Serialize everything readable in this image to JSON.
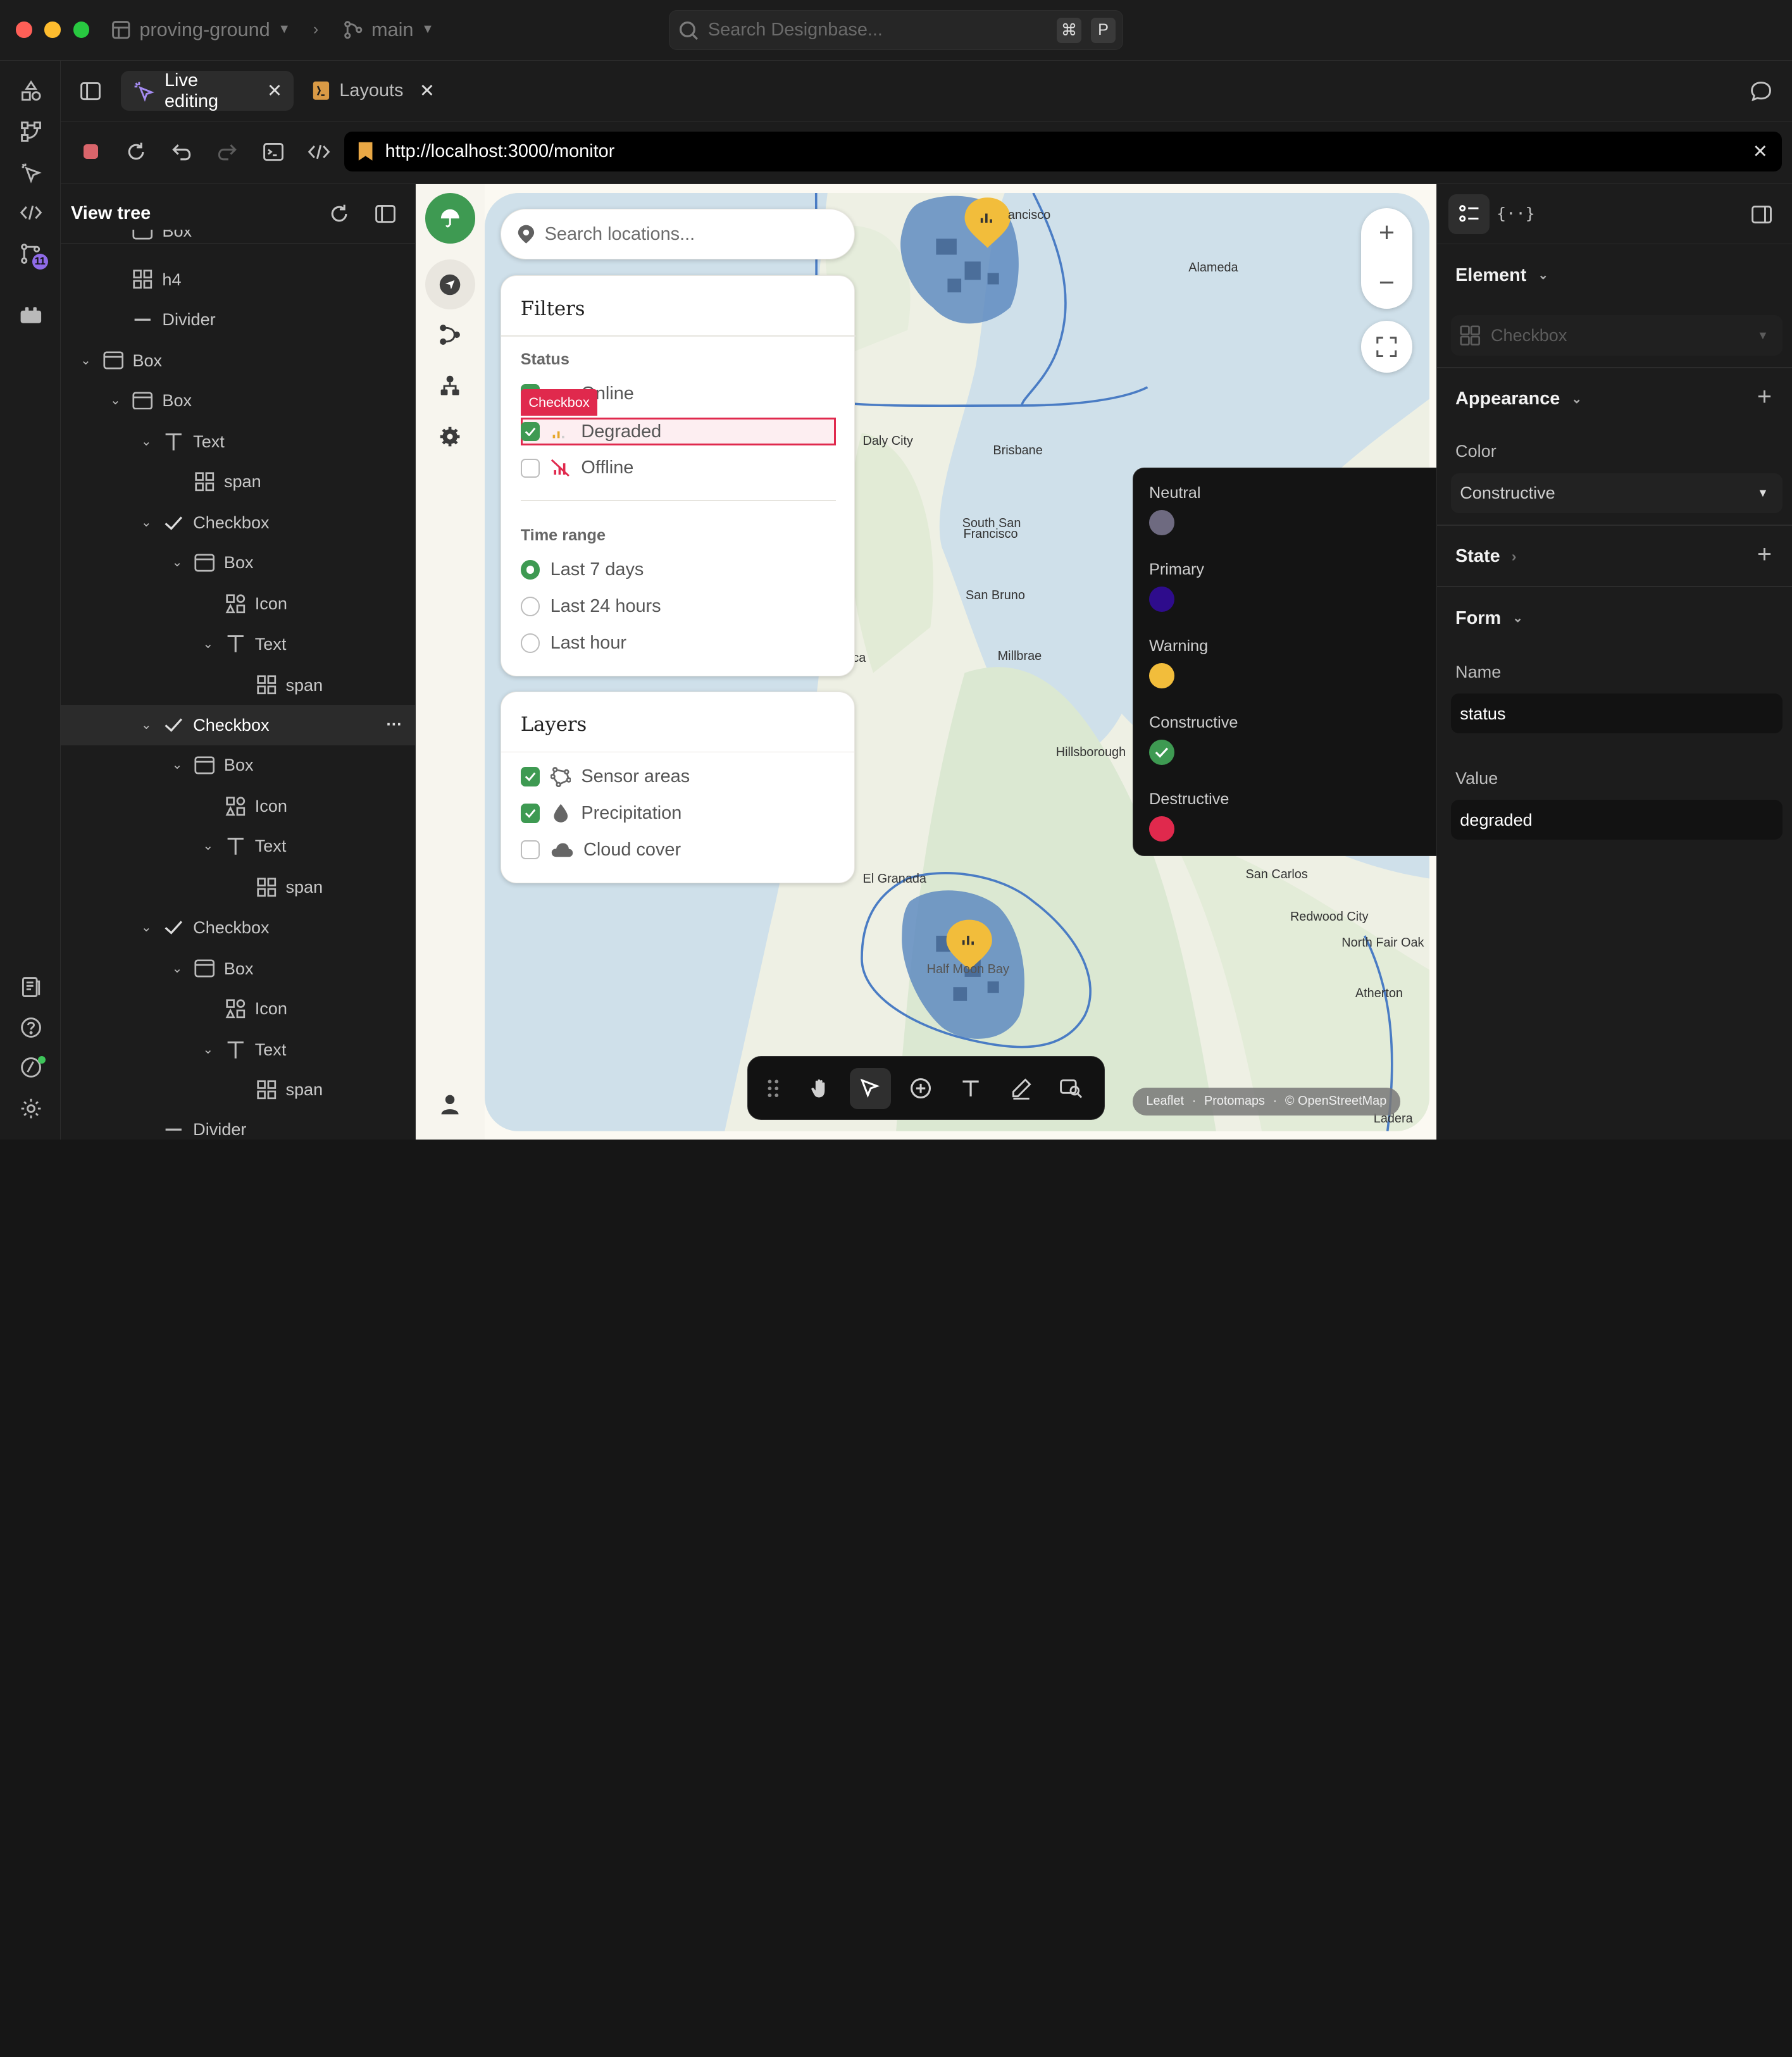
{
  "titlebar": {
    "project": "proving-ground",
    "branch": "main",
    "search_placeholder": "Search Designbase...",
    "shortcut_cmd": "⌘",
    "shortcut_key": "P"
  },
  "tabs": [
    {
      "label": "Live editing"
    },
    {
      "label": "Layouts"
    }
  ],
  "address": {
    "url": "http://localhost:3000/monitor"
  },
  "rail": {
    "badge_count": "11"
  },
  "tree": {
    "title": "View tree",
    "rows": [
      {
        "label": "h4"
      },
      {
        "label": "Divider"
      },
      {
        "label": "Box"
      },
      {
        "label": "Box"
      },
      {
        "label": "Text"
      },
      {
        "label": "span"
      },
      {
        "label": "Checkbox"
      },
      {
        "label": "Box"
      },
      {
        "label": "Icon"
      },
      {
        "label": "Text"
      },
      {
        "label": "span"
      },
      {
        "label": "Checkbox"
      },
      {
        "label": "Box"
      },
      {
        "label": "Icon"
      },
      {
        "label": "Text"
      },
      {
        "label": "span"
      },
      {
        "label": "Checkbox"
      },
      {
        "label": "Box"
      },
      {
        "label": "Icon"
      },
      {
        "label": "Text"
      },
      {
        "label": "span"
      },
      {
        "label": "Divider"
      }
    ],
    "top_clipped": "Box"
  },
  "app": {
    "search_placeholder": "Search locations...",
    "filters": {
      "title": "Filters",
      "status_label": "Status",
      "status_options": [
        {
          "label": "Online",
          "checked": true
        },
        {
          "label": "Degraded",
          "checked": true
        },
        {
          "label": "Offline",
          "checked": false
        }
      ],
      "highlight_tag": "Checkbox",
      "time_label": "Time range",
      "time_options": [
        {
          "label": "Last 7 days",
          "selected": true
        },
        {
          "label": "Last 24 hours",
          "selected": false
        },
        {
          "label": "Last hour",
          "selected": false
        }
      ]
    },
    "layers": {
      "title": "Layers",
      "options": [
        {
          "label": "Sensor areas",
          "checked": true
        },
        {
          "label": "Precipitation",
          "checked": true
        },
        {
          "label": "Cloud cover",
          "checked": false
        }
      ]
    },
    "map": {
      "places": [
        "ancisco",
        "Alameda",
        "Daly City",
        "Brisbane",
        "South San",
        "Francisco",
        "San Bruno",
        "Millbrae",
        "ca",
        "Hillsborough",
        "El Granada",
        "Half Moon Bay",
        "San Carlos",
        "Redwood City",
        "North Fair Oak",
        "Atherton",
        "Ladera"
      ],
      "attribution": [
        "Leaflet",
        "·",
        "Protomaps",
        "·",
        "© OpenStreetMap"
      ]
    }
  },
  "popover": {
    "colors": [
      {
        "name": "Neutral",
        "hex": "#6e6a80"
      },
      {
        "name": "Primary",
        "hex": "#2e0c8c"
      },
      {
        "name": "Warning",
        "hex": "#f2bd3b"
      },
      {
        "name": "Constructive",
        "hex": "#3e9a52"
      },
      {
        "name": "Destructive",
        "hex": "#e0294d"
      }
    ]
  },
  "inspector": {
    "element_label": "Element",
    "element_value": "Checkbox",
    "appearance_label": "Appearance",
    "color_label": "Color",
    "color_value": "Constructive",
    "state_label": "State",
    "form_label": "Form",
    "name_label": "Name",
    "name_value": "status",
    "value_label": "Value",
    "value_value": "degraded"
  },
  "colors": {
    "accent_green": "#3e9a52",
    "highlight_red": "#e0294d",
    "marker_yellow": "#f2bd3b",
    "rain_blue": "#5a88c0"
  }
}
